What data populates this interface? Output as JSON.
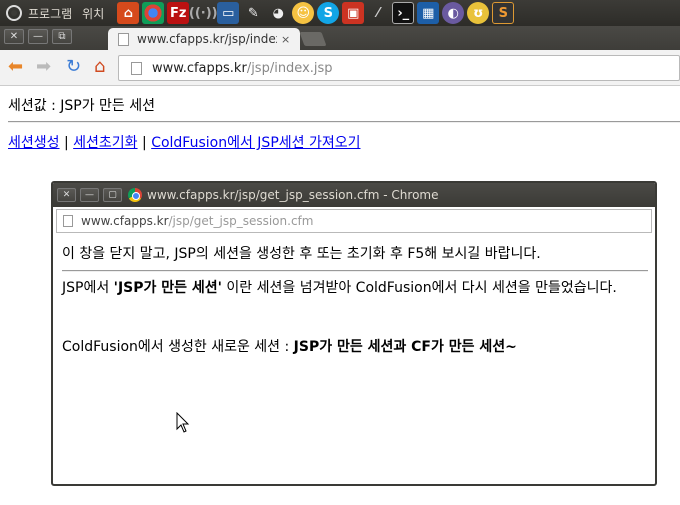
{
  "system_panel": {
    "menus": [
      "프로그램",
      "위치"
    ]
  },
  "browser": {
    "tab_title": "www.cfapps.kr/jsp/index",
    "tab_close": "×",
    "url_host": "www.cfapps.kr",
    "url_path": "/jsp/index.jsp"
  },
  "page": {
    "session_value": "세션값 : JSP가 만든 세션",
    "links": [
      "세션생성",
      "세션초기화",
      "ColdFusion에서 JSP세션 가져오기"
    ],
    "separator": "|"
  },
  "popup": {
    "title": "www.cfapps.kr/jsp/get_jsp_session.cfm - Chrome",
    "url_host": "www.cfapps.kr",
    "url_path": "/jsp/get_jsp_session.cfm",
    "notice": "이 창을 닫지 말고, JSP의 세션을 생성한 후 또는 초기화 후 F5해 보시길 바랍니다.",
    "line2_prefix": "JSP에서 ",
    "line2_bold": "'JSP가 만든 세션'",
    "line2_suffix": " 이란 세션을 넘겨받아 ColdFusion에서 다시 세션을 만들었습니다.",
    "line3_prefix": "ColdFusion에서 생성한 새로운 세션 : ",
    "line3_bold": "JSP가 만든 세션과 CF가 만든 세션~"
  },
  "colors": {
    "link": "#0000ee",
    "panel": "#3c3b37"
  }
}
